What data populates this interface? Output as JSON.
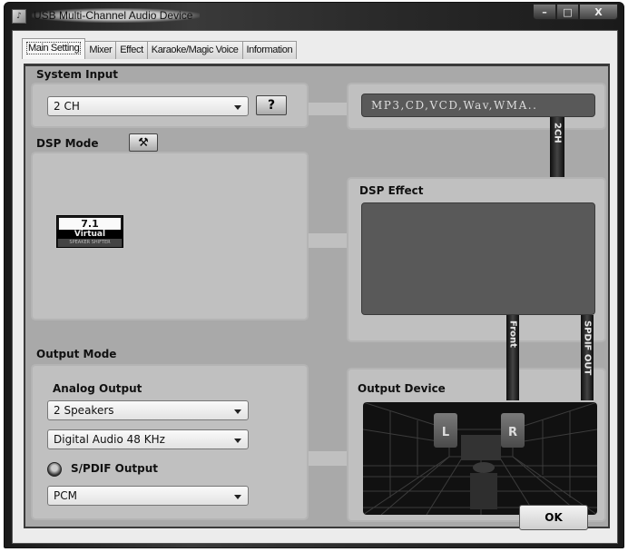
{
  "window": {
    "title": "USB Multi-Channel Audio Device",
    "icon": "app-icon",
    "caption_buttons": {
      "minimize": "–",
      "maximize": "□",
      "close": "X"
    }
  },
  "tabs": [
    {
      "label": "Main Setting",
      "active": true
    },
    {
      "label": "Mixer",
      "active": false
    },
    {
      "label": "Effect",
      "active": false
    },
    {
      "label": "Karaoke/Magic Voice",
      "active": false
    },
    {
      "label": "Information",
      "active": false
    }
  ],
  "system_input": {
    "label": "System Input",
    "selected": "2 CH",
    "help_button": "?",
    "source_formats": "MP3,CD,VCD,Wav,WMA..",
    "channel_strip": "2CH"
  },
  "dsp_mode": {
    "label": "DSP Mode",
    "tool_button_icon": "hammer-icon",
    "badge": {
      "top": "7.1",
      "middle": "Virtual",
      "bottom": "SPEAKER SHIFTER"
    }
  },
  "dsp_effect": {
    "label": "DSP Effect"
  },
  "output_mode": {
    "label": "Output Mode",
    "analog_label": "Analog Output",
    "speakers_selected": "2 Speakers",
    "sample_rate_selected": "Digital Audio 48 KHz",
    "spdif_label": "S/PDIF Output",
    "spdif_selected": "PCM"
  },
  "output_device": {
    "label": "Output Device",
    "front_strip": "Front",
    "spdif_strip": "SPDIF OUT",
    "speaker_left": "L",
    "speaker_right": "R"
  },
  "footer": {
    "ok_label": "OK"
  }
}
